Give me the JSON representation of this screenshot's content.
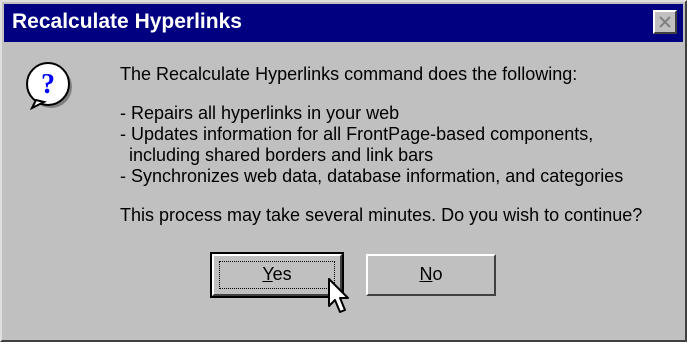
{
  "window": {
    "title": "Recalculate Hyperlinks",
    "close_icon": "close-icon"
  },
  "icon": {
    "type": "question-icon",
    "glyph": "?"
  },
  "message": {
    "intro": "The Recalculate Hyperlinks command does the following:",
    "items": [
      "- Repairs all hyperlinks in your web",
      "- Updates information for all FrontPage-based components,",
      "including shared borders and link bars",
      "- Synchronizes web data, database information, and categories"
    ],
    "question": "This process may take several minutes.  Do you wish to continue?"
  },
  "buttons": {
    "yes": {
      "mnemonic": "Y",
      "rest": "es"
    },
    "no": {
      "mnemonic": "N",
      "rest": "o"
    }
  },
  "colors": {
    "titlebar": "#000080",
    "face": "#c0c0c0"
  }
}
